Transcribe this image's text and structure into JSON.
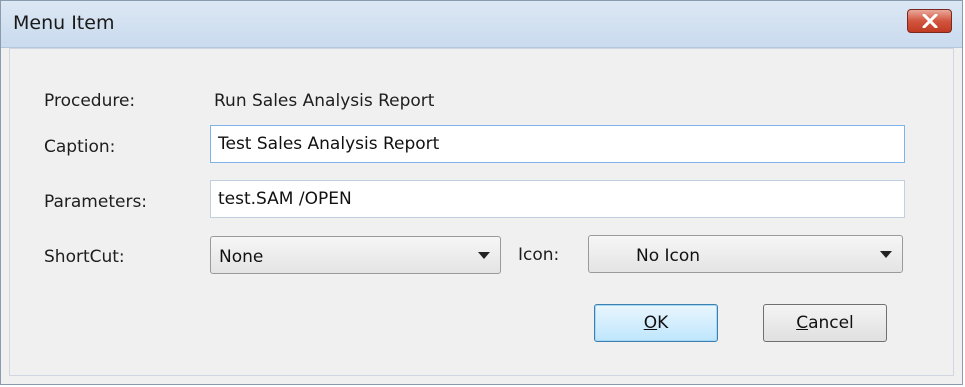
{
  "window": {
    "title": "Menu Item"
  },
  "form": {
    "procedure_label": "Procedure:",
    "procedure_value": "Run Sales Analysis Report",
    "caption_label": "Caption:",
    "caption_value": "Test Sales Analysis Report",
    "parameters_label": "Parameters:",
    "parameters_value": "test.SAM /OPEN",
    "shortcut_label": "ShortCut:",
    "shortcut_value": "None",
    "icon_label": "Icon:",
    "icon_value": "No Icon"
  },
  "buttons": {
    "ok_accel": "O",
    "ok_rest": "K",
    "cancel_accel": "C",
    "cancel_rest": "ancel"
  },
  "icons": {
    "close": "close-icon",
    "dropdown": "chevron-down-icon"
  },
  "colors": {
    "close_button": "#d2553e",
    "default_button": "#bee6fd",
    "focus_border": "#7eb4ea"
  }
}
